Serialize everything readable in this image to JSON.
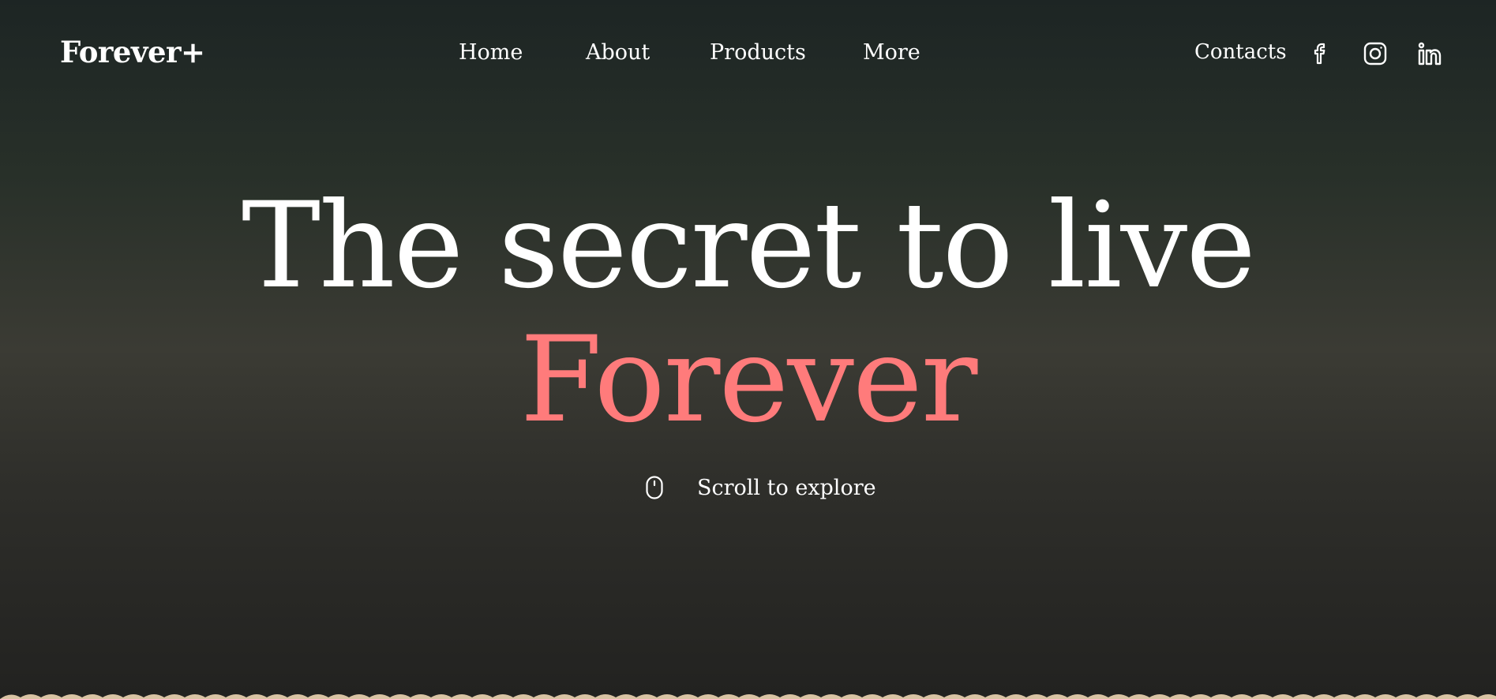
{
  "header": {
    "logo": "Forever+",
    "nav": [
      {
        "label": "Home"
      },
      {
        "label": "About"
      },
      {
        "label": "Products"
      },
      {
        "label": "More"
      }
    ],
    "contacts_label": "Contacts",
    "social": [
      {
        "icon": "facebook-icon"
      },
      {
        "icon": "instagram-icon"
      },
      {
        "icon": "linkedin-icon"
      }
    ]
  },
  "hero": {
    "line1": "The secret to live",
    "line2": "Forever",
    "accent_color": "#ff7b7b"
  },
  "scroll_hint": {
    "icon": "mouse-icon",
    "text": "Scroll to explore"
  },
  "colors": {
    "text": "#ffffff",
    "accent": "#ff7b7b",
    "background_top": "#1d2524",
    "background_mid": "#3b3b34",
    "border_beige": "#d9c3a3"
  }
}
